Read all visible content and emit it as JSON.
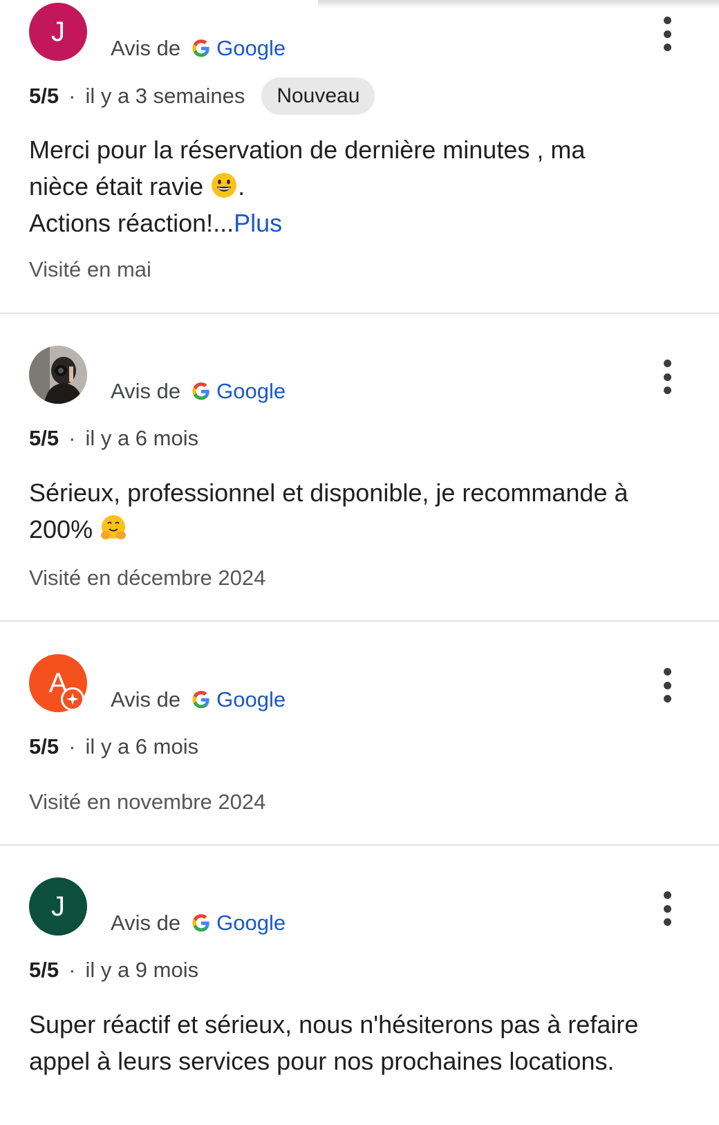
{
  "colors": {
    "avatar_1": "#c2185b",
    "avatar_2": "#3a3a3a",
    "avatar_3": "#f4511e",
    "avatar_4": "#0b4f3c",
    "link": "#1a57c9",
    "badge_bg": "#e8e8e8"
  },
  "reviews": [
    {
      "avatar_letter": "J",
      "source_prefix": "Avis de",
      "source_brand": "Google",
      "rating": "5/5",
      "separator": "·",
      "time": "il y a 3 semaines",
      "badge": "Nouveau",
      "text_line1": "Merci pour la réservation de dernière minutes , ma",
      "text_line2_a": "nièce était ravie",
      "text_line2_b": ".",
      "text_line3": "Actions réaction!...",
      "more": "Plus",
      "visited": "Visité en mai",
      "emoji": "grinning-face"
    },
    {
      "avatar_letter": "",
      "avatar_image": "profile-photo",
      "source_prefix": "Avis de",
      "source_brand": "Google",
      "rating": "5/5",
      "separator": "·",
      "time": "il y a 6 mois",
      "text_line1": "Sérieux, professionnel et disponible, je recommande à",
      "text_line2_a": "200%",
      "visited": "Visité en décembre 2024",
      "emoji": "hugging-face"
    },
    {
      "avatar_letter": "A",
      "source_prefix": "Avis de",
      "source_brand": "Google",
      "rating": "5/5",
      "separator": "·",
      "time": "il y a 6 mois",
      "visited": "Visité en novembre 2024",
      "badge_icon": "local-guide-star-icon"
    },
    {
      "avatar_letter": "J",
      "source_prefix": "Avis de",
      "source_brand": "Google",
      "rating": "5/5",
      "separator": "·",
      "time": "il y a 9 mois",
      "text_line1": "Super réactif et sérieux, nous n'hésiterons pas à refaire",
      "text_line2_a": "appel à leurs services pour nos prochaines locations."
    }
  ]
}
